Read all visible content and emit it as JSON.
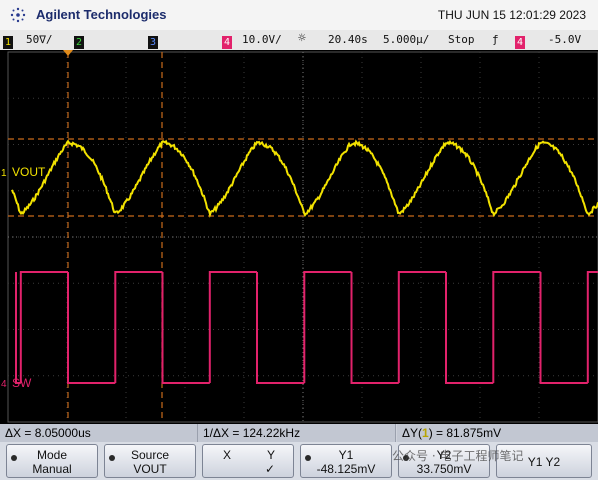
{
  "header": {
    "brand": "Agilent Technologies",
    "datetime": "THU JUN 15 12:01:29 2023"
  },
  "status": {
    "ch1_num": "1",
    "ch1_scale": "50∇/",
    "ch2_num": "2",
    "ch3_num": "3",
    "ch4_num": "4",
    "ch4_scale": "10.0V/",
    "trigger_pos": "20.40s",
    "timebase": "5.000µ/",
    "run_state": "Stop",
    "trig_slope": "ƒ",
    "trig_src": "4",
    "trig_level": "-5.0V"
  },
  "traces": {
    "vout_label": "VOUT",
    "sw_label": "SW",
    "vout_marker": "1",
    "sw_marker": "4",
    "vout_color": "#f2e200",
    "sw_color": "#e2226b",
    "vout_periods_visible": 6.2
  },
  "measurements": {
    "delta_x": "ΔX = 8.05000us",
    "inv_delta_x": "1/ΔX = 124.22kHz",
    "delta_y_prefix": "ΔY(",
    "delta_y_ch": "1",
    "delta_y_suffix": ") = 81.875mV"
  },
  "softkeys": {
    "mode_label": "Mode",
    "mode_value": "Manual",
    "source_label": "Source",
    "source_value": "VOUT",
    "x_label": "X",
    "y_label": "Y",
    "check_glyph": "✓",
    "y1_label": "Y1",
    "y1_value": "-48.125mV",
    "y2_label": "Y2",
    "y2_value": "33.750mV",
    "y1y2_label": "Y1 Y2"
  },
  "watermark": "公众号 · 电子工程师笔记"
}
